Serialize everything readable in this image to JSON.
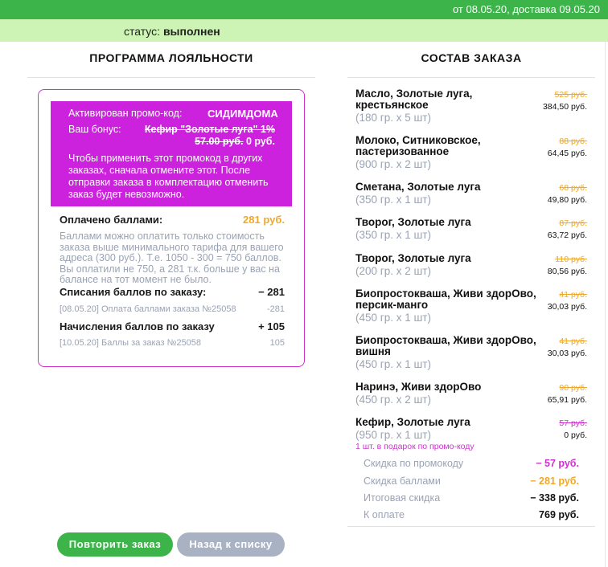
{
  "header": {
    "dates": "от 08.05.20, доставка 09.05.20",
    "status_label": "статус:",
    "status_value": "выполнен"
  },
  "loyalty": {
    "title": "ПРОГРАММА ЛОЯЛЬНОСТИ",
    "promo_activated_label": "Активирован промо-код:",
    "promo_code": "СИДИМДОМА",
    "bonus_label": "Ваш бонус:",
    "bonus_product": "Кефир \"Золотые луга\" 1%",
    "bonus_old_price": "57.00 руб.",
    "bonus_new_price": "0 руб.",
    "promo_note": "Чтобы применить этот промокод в других заказах, сначала отмените этот. После отправки заказа в комплектацию отменить заказ будет невозможно.",
    "paid_label": "Оплачено баллами:",
    "paid_value": "281 руб.",
    "paid_note": "Баллами можно оплатить только стоимость заказа выше минимального тарифа для вашего адреса (300 руб.). Т.е. 1050 - 300 = 750 баллов. Вы оплатили не 750, а 281 т.к. больше у вас на балансе на тот момент не было.",
    "writeoff_label": "Списания баллов по заказу:",
    "writeoff_value": "− 281",
    "writeoff_entry": "[08.05.20] Оплата баллами заказа №25058",
    "writeoff_entry_value": "-281",
    "accrual_label": "Начисления баллов по заказу",
    "accrual_value": "+ 105",
    "accrual_entry": "[10.05.20] Баллы за заказ №25058",
    "accrual_entry_value": "105"
  },
  "order": {
    "title": "СОСТАВ ЗАКАЗА",
    "items": [
      {
        "name": "Масло, Золотые луга, крестьянское",
        "qty": "(180 гр. x 5 шт)",
        "old": "525 руб.",
        "new": "384,50 руб."
      },
      {
        "name": "Молоко, Ситниковское, пастеризованное",
        "qty": "(900 гр. x 2 шт)",
        "old": "88 руб.",
        "new": "64,45 руб."
      },
      {
        "name": "Сметана, Золотые луга",
        "qty": "(350 гр. x 1 шт)",
        "old": "68 руб.",
        "new": "49,80 руб."
      },
      {
        "name": "Творог, Золотые луга",
        "qty": "(350 гр. x 1 шт)",
        "old": "87 руб.",
        "new": "63,72 руб."
      },
      {
        "name": "Творог, Золотые луга",
        "qty": "(200 гр. x 2 шт)",
        "old": "110 руб.",
        "new": "80,56 руб."
      },
      {
        "name": "Биопростокваша, Живи здорОво, персик-манго",
        "qty": "(450 гр. x 1 шт)",
        "old": "41 руб.",
        "new": "30,03 руб."
      },
      {
        "name": "Биопростокваша, Живи здорОво, вишня",
        "qty": "(450 гр. x 1 шт)",
        "old": "41 руб.",
        "new": "30,03 руб."
      },
      {
        "name": "Наринэ, Живи здорОво",
        "qty": "(450 гр. x 2 шт)",
        "old": "90 руб.",
        "new": "65,91 руб."
      },
      {
        "name": "Кефир, Золотые луга",
        "qty": "(950 гр. x 1 шт)",
        "old": "57 руб.",
        "new": "0 руб.",
        "gift": "1 шт. в подарок по промо-коду"
      }
    ],
    "totals": {
      "promo_label": "Скидка по промокоду",
      "promo_value": "− 57 руб.",
      "points_label": "Скидка баллами",
      "points_value": "− 281 руб.",
      "total_discount_label": "Итоговая скидка",
      "total_discount_value": "− 338 руб.",
      "to_pay_label": "К оплате",
      "to_pay_value": "769 руб."
    }
  },
  "buttons": {
    "repeat": "Повторить заказ",
    "back": "Назад к списку"
  },
  "colors": {
    "green": "#3cb44a",
    "light_green": "#cdf4b4",
    "magenta": "#cc22dd",
    "orange": "#f0a82a",
    "grey_text": "#9aa3b4"
  }
}
